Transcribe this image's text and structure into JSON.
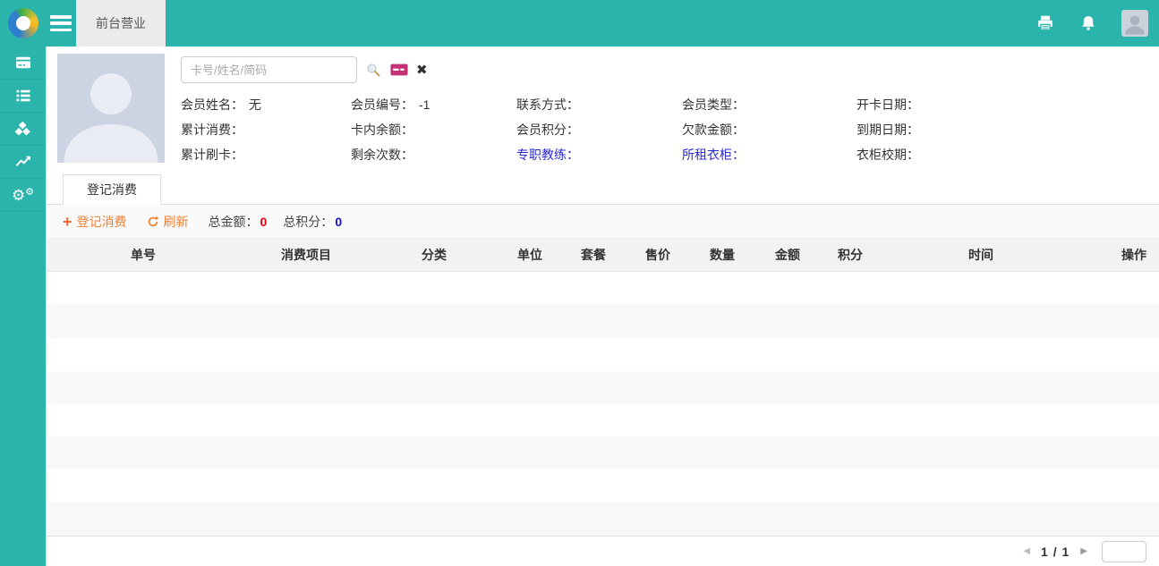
{
  "app": {
    "accent_teal": "#2ab4ab",
    "orange": "#ef8038",
    "link_blue": "#2b2bd5",
    "red": "#e60012",
    "blue": "#1212cd"
  },
  "header": {
    "tab_label": "前台营业"
  },
  "sidebar": {
    "items": [
      {
        "icon": "pos-card-icon"
      },
      {
        "icon": "list-icon"
      },
      {
        "icon": "cubes-icon"
      },
      {
        "icon": "line-chart-icon"
      },
      {
        "icon": "gears-icon",
        "glyph": "⚙"
      }
    ]
  },
  "member": {
    "search": {
      "placeholder": "卡号/姓名/简码"
    },
    "rows": [
      [
        {
          "label": "会员姓名：",
          "value": "无"
        },
        {
          "label": "会员编号：",
          "value": "-1"
        },
        {
          "label": "联系方式：",
          "value": ""
        },
        {
          "label": "会员类型：",
          "value": ""
        },
        {
          "label": "开卡日期：",
          "value": ""
        }
      ],
      [
        {
          "label": "累计消费：",
          "value": ""
        },
        {
          "label": "卡内余额：",
          "value": ""
        },
        {
          "label": "会员积分：",
          "value": ""
        },
        {
          "label": "欠款金额：",
          "value": ""
        },
        {
          "label": "到期日期：",
          "value": ""
        }
      ],
      [
        {
          "label": "累计刷卡：",
          "value": ""
        },
        {
          "label": "剩余次数：",
          "value": ""
        },
        {
          "label": "专职教练：",
          "value": ""
        },
        {
          "label": "所租衣柜：",
          "value": ""
        },
        {
          "label": "衣柜校期：",
          "value": ""
        }
      ]
    ]
  },
  "tabs": {
    "active_label": "登记消费"
  },
  "toolbar": {
    "add_label": "登记消费",
    "refresh_label": "刷新",
    "total_amount_label": "总金额：",
    "total_amount_value": "0",
    "total_points_label": "总积分：",
    "total_points_value": "0"
  },
  "table": {
    "columns": [
      "单号",
      "消费项目",
      "分类",
      "单位",
      "套餐",
      "售价",
      "数量",
      "金额",
      "积分",
      "时间",
      "操作"
    ],
    "row_count": 8
  },
  "pagination": {
    "current": "1",
    "separator": "/",
    "total": "1"
  }
}
